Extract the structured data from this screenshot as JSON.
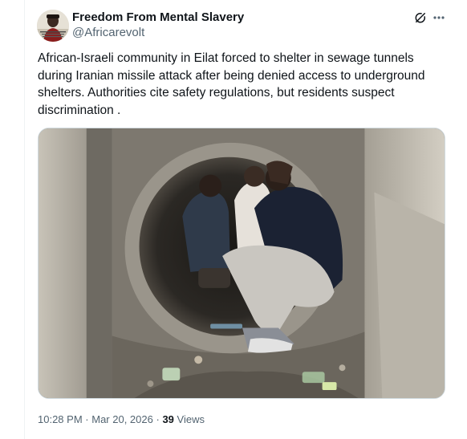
{
  "author": {
    "display_name": "Freedom From Mental Slavery",
    "handle": "@Africarevolt",
    "avatar_icon": "portrait-avatar"
  },
  "tweet": {
    "text": "African-Israeli community in Eilat forced to shelter in sewage tunnels during Iranian missile attack after being denied access to underground shelters. Authorities cite safety regulations, but residents suspect discrimination .",
    "media_alt_icon": "photo-people-crouching-in-tunnel"
  },
  "meta": {
    "time": "10:28 PM",
    "separator": "·",
    "date": "Mar 20, 2026",
    "views_count": "39",
    "views_label": "Views"
  },
  "icons": {
    "grok": "grok-icon",
    "more": "more-icon"
  },
  "colors": {
    "text_primary": "#0f1419",
    "text_secondary": "#536471",
    "border": "#cfd9de"
  }
}
